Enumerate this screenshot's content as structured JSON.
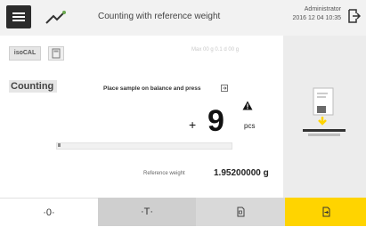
{
  "header": {
    "title": "Counting with reference weight",
    "user": "Administrator",
    "datetime": "2016 12 04   10:35"
  },
  "toolbar": {
    "isocal_label": "isoCAL"
  },
  "faint_info": "Max 00 g   0.1 d 00 g",
  "main": {
    "mode_label": "Counting",
    "instruction": "Place sample on balance and press",
    "sign": "+",
    "value": "9",
    "unit": "pcs",
    "reference_label": "Reference weight",
    "reference_value": "1.95200000 g"
  },
  "footer": {
    "zero_label": "·0·",
    "tare_label": "·T·"
  },
  "colors": {
    "accent": "#ffd400",
    "tare_bg": "#cfcfcf"
  }
}
